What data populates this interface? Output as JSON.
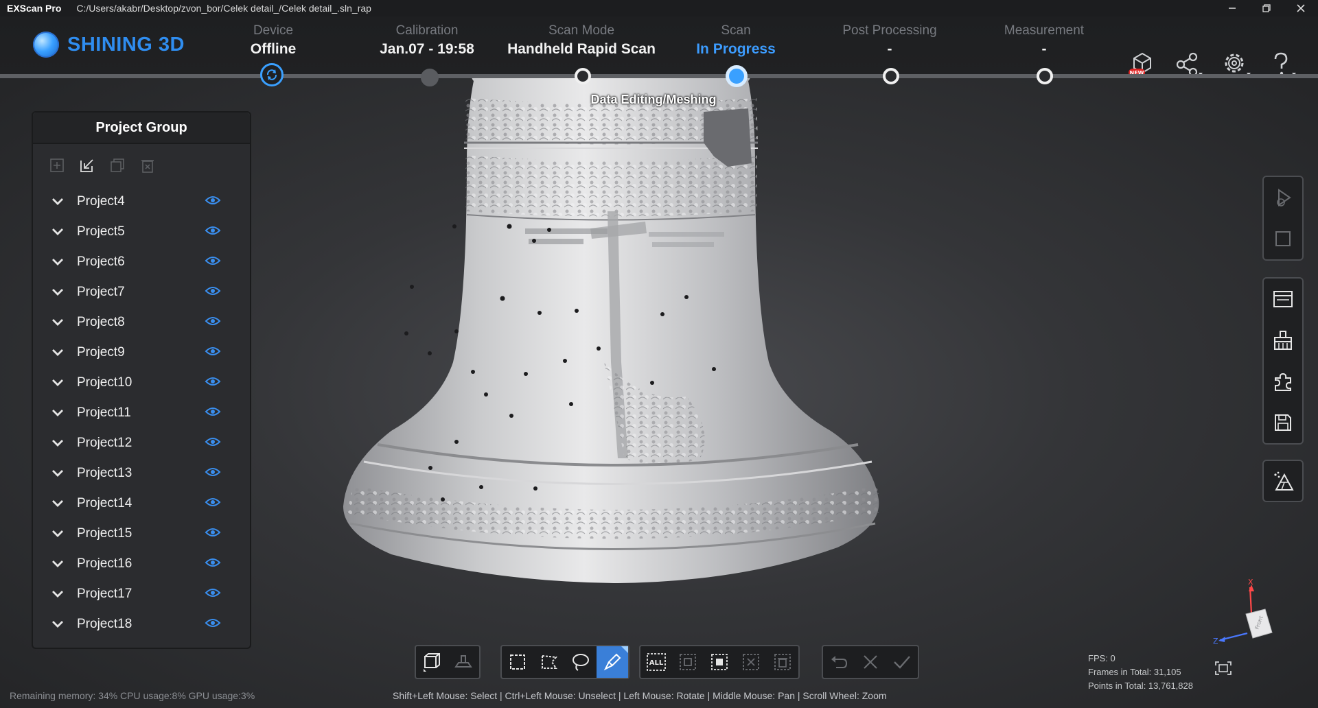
{
  "titlebar": {
    "app": "EXScan Pro",
    "path": "C:/Users/akabr/Desktop/zvon_bor/Celek detail_/Celek detail_.sln_rap"
  },
  "logo": {
    "text": "SHINING 3D"
  },
  "steps": [
    {
      "label": "Device",
      "value": "Offline"
    },
    {
      "label": "Calibration",
      "value": "Jan.07 - 19:58"
    },
    {
      "label": "Scan Mode",
      "value": "Handheld Rapid Scan"
    },
    {
      "label": "Scan",
      "value": "In Progress"
    },
    {
      "label": "Post Processing",
      "value": "-"
    },
    {
      "label": "Measurement",
      "value": "-"
    }
  ],
  "stage_caption": "Data Editing/Meshing",
  "header_icons": [
    "new-badge-icon",
    "share-icon",
    "settings-icon",
    "help-icon"
  ],
  "new_badge": "NEW",
  "panel": {
    "title": "Project Group",
    "tools": [
      "add-project-icon",
      "edit-project-icon",
      "copy-project-icon",
      "delete-project-icon"
    ],
    "projects": [
      {
        "name": "Project4"
      },
      {
        "name": "Project5"
      },
      {
        "name": "Project6"
      },
      {
        "name": "Project7"
      },
      {
        "name": "Project8"
      },
      {
        "name": "Project9"
      },
      {
        "name": "Project10"
      },
      {
        "name": "Project11"
      },
      {
        "name": "Project12"
      },
      {
        "name": "Project13"
      },
      {
        "name": "Project14"
      },
      {
        "name": "Project15"
      },
      {
        "name": "Project16"
      },
      {
        "name": "Project17"
      },
      {
        "name": "Project18"
      }
    ]
  },
  "bottom_toolbar": {
    "all_label": "ALL"
  },
  "status": {
    "left": "Remaining memory: 34% CPU usage:8%  GPU usage:3%",
    "hints": "Shift+Left Mouse: Select | Ctrl+Left Mouse: Unselect | Left Mouse: Rotate | Middle Mouse: Pan | Scroll Wheel: Zoom"
  },
  "stats": {
    "fps": "FPS: 0",
    "frames": "Frames in Total: 31,105",
    "points": "Points in Total: 13,761,828"
  },
  "axis": {
    "x": "X",
    "z": "Z",
    "cube_face": "Front"
  },
  "colors": {
    "accent": "#3aa0ff",
    "background": "#262729",
    "panel": "#2b2c2f"
  }
}
